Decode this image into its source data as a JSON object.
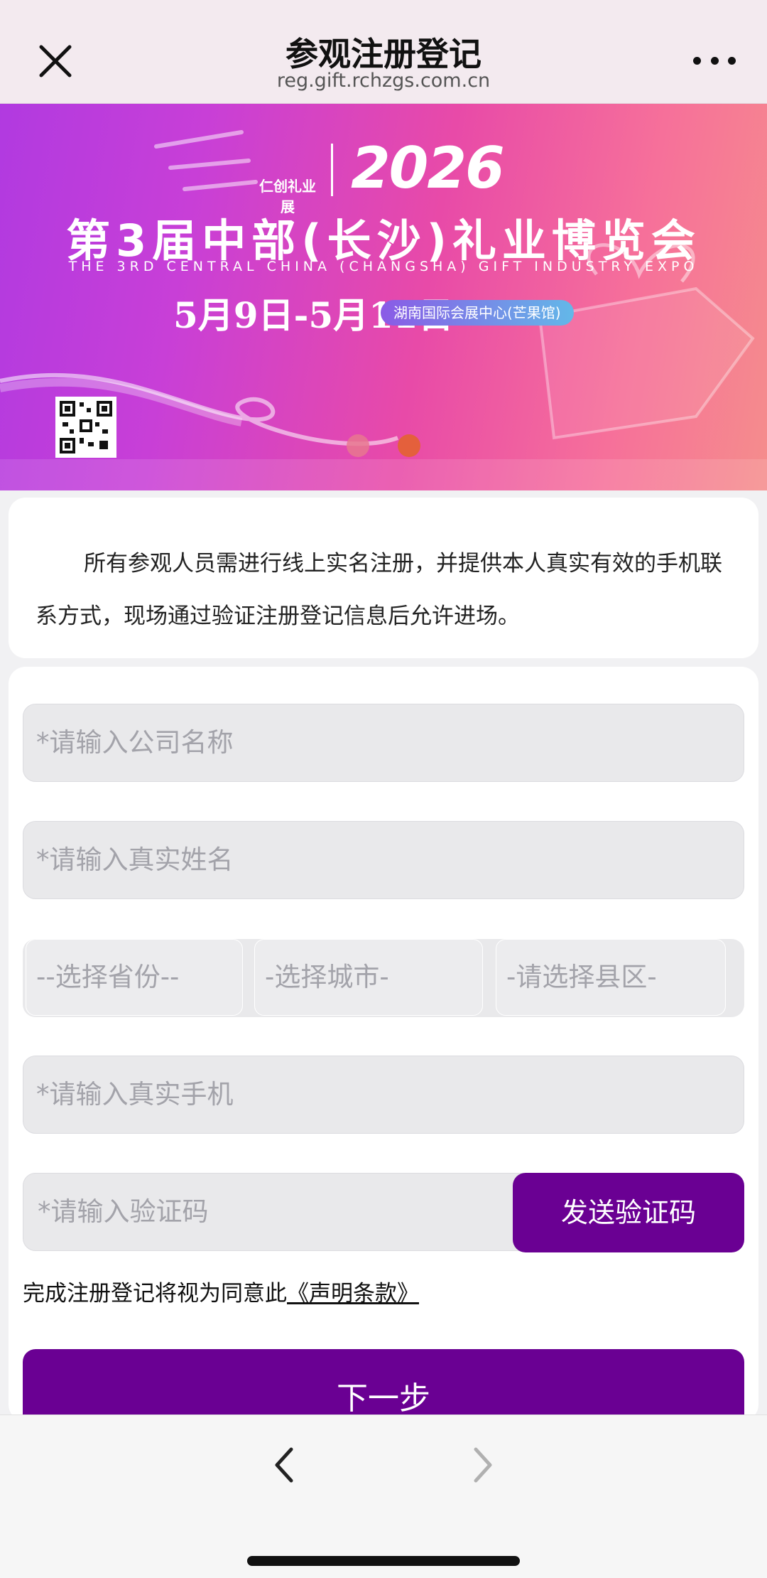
{
  "nav": {
    "title": "参观注册登记",
    "url": "reg.gift.rchzgs.com.cn"
  },
  "banner": {
    "logo_text": "仁创礼业展",
    "year": "2026",
    "title": "第3届中部(长沙)礼业博览会",
    "subtitle": "THE 3RD CENTRAL CHINA (CHANGSHA) GIFT INDUSTRY EXPO",
    "date": "5月9日-5月11日",
    "venue": "湖南国际会展中心(芒果馆)",
    "slide_count": 2,
    "active_slide": 2
  },
  "notice": {
    "text": "所有参观人员需进行线上实名注册，并提供本人真实有效的手机联系方式，现场通过验证注册登记信息后允许进场。"
  },
  "form": {
    "company_placeholder": "*请输入公司名称",
    "name_placeholder": "*请输入真实姓名",
    "province_placeholder": "--选择省份--",
    "city_placeholder": "-选择城市-",
    "district_placeholder": "-请选择县区-",
    "phone_placeholder": "*请输入真实手机",
    "code_placeholder": "*请输入验证码",
    "send_code_label": "发送验证码",
    "agree_prefix": "完成注册登记将视为同意此",
    "agree_link": "《声明条款》",
    "next_label": "下一步"
  },
  "colors": {
    "primary": "#6a0093",
    "banner_start": "#b13ae0",
    "banner_end": "#f58d8c"
  }
}
